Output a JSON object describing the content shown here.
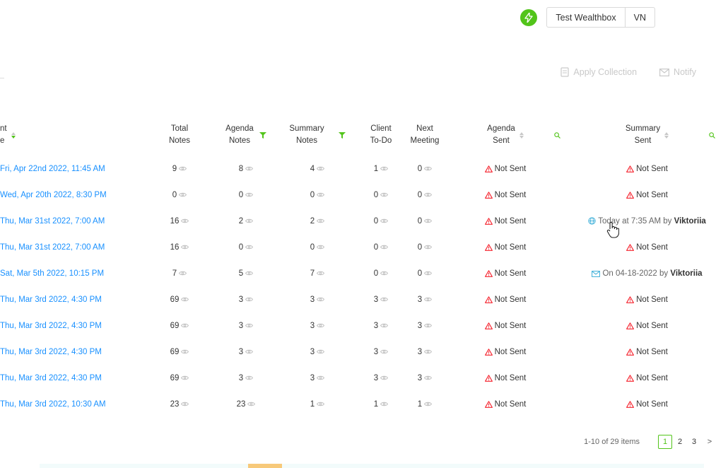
{
  "header": {
    "workspace": "Test Wealthbox",
    "initials": "VN"
  },
  "toolbar": {
    "apply_collection": "Apply Collection",
    "notify": "Notify"
  },
  "columns": {
    "date_top": "nt",
    "date_bottom": "e",
    "total_top": "Total",
    "total_bottom": "Notes",
    "agenda_top": "Agenda",
    "agenda_bottom": "Notes",
    "summary_top": "Summary",
    "summary_bottom": "Notes",
    "todo_top": "Client",
    "todo_bottom": "To-Do",
    "next_top": "Next",
    "next_bottom": "Meeting",
    "asent_top": "Agenda",
    "asent_bottom": "Sent",
    "ssent_top": "Summary",
    "ssent_bottom": "Sent"
  },
  "rows": [
    {
      "date": "Fri, Apr 22nd 2022, 11:45 AM",
      "total": "9",
      "agenda": "8",
      "summary": "4",
      "todo": "1",
      "next": "0",
      "agenda_sent": "Not Sent",
      "summary_sent": "Not Sent"
    },
    {
      "date": "Wed, Apr 20th 2022, 8:30 PM",
      "total": "0",
      "agenda": "0",
      "summary": "0",
      "todo": "0",
      "next": "0",
      "agenda_sent": "Not Sent",
      "summary_sent": "Not Sent"
    },
    {
      "date": "Thu, Mar 31st 2022, 7:00 AM",
      "total": "16",
      "agenda": "2",
      "summary": "2",
      "todo": "0",
      "next": "0",
      "agenda_sent": "Not Sent",
      "summary_sent_type": "web",
      "summary_sent_text": "Today at 7:35 AM by",
      "summary_sent_user": "Viktoriia"
    },
    {
      "date": "Thu, Mar 31st 2022, 7:00 AM",
      "total": "16",
      "agenda": "0",
      "summary": "0",
      "todo": "0",
      "next": "0",
      "agenda_sent": "Not Sent",
      "summary_sent": "Not Sent"
    },
    {
      "date": "Sat, Mar 5th 2022, 10:15 PM",
      "total": "7",
      "agenda": "5",
      "summary": "7",
      "todo": "0",
      "next": "0",
      "agenda_sent": "Not Sent",
      "summary_sent_type": "mail",
      "summary_sent_text": "On 04-18-2022 by",
      "summary_sent_user": "Viktoriia"
    },
    {
      "date": "Thu, Mar 3rd 2022, 4:30 PM",
      "total": "69",
      "agenda": "3",
      "summary": "3",
      "todo": "3",
      "next": "3",
      "agenda_sent": "Not Sent",
      "summary_sent": "Not Sent"
    },
    {
      "date": "Thu, Mar 3rd 2022, 4:30 PM",
      "total": "69",
      "agenda": "3",
      "summary": "3",
      "todo": "3",
      "next": "3",
      "agenda_sent": "Not Sent",
      "summary_sent": "Not Sent"
    },
    {
      "date": "Thu, Mar 3rd 2022, 4:30 PM",
      "total": "69",
      "agenda": "3",
      "summary": "3",
      "todo": "3",
      "next": "3",
      "agenda_sent": "Not Sent",
      "summary_sent": "Not Sent"
    },
    {
      "date": "Thu, Mar 3rd 2022, 4:30 PM",
      "total": "69",
      "agenda": "3",
      "summary": "3",
      "todo": "3",
      "next": "3",
      "agenda_sent": "Not Sent",
      "summary_sent": "Not Sent"
    },
    {
      "date": "Thu, Mar 3rd 2022, 10:30 AM",
      "total": "23",
      "agenda": "23",
      "summary": "1",
      "todo": "1",
      "next": "1",
      "agenda_sent": "Not Sent",
      "summary_sent": "Not Sent"
    }
  ],
  "pagination": {
    "range": "1-10 of 29 items",
    "pages": [
      "1",
      "2",
      "3"
    ],
    "current": "1",
    "next": ">"
  },
  "icons": [
    "lightning-icon",
    "apply-collection-icon",
    "mail-icon",
    "sort-icon",
    "funnel-icon",
    "search-icon",
    "eye-icon",
    "warning-icon",
    "globe-icon",
    "cursor-hand-icon"
  ],
  "colors": {
    "accent": "#52c41a",
    "link": "#1890ff",
    "warning": "#f5222d",
    "muted": "#c9c9c9"
  }
}
